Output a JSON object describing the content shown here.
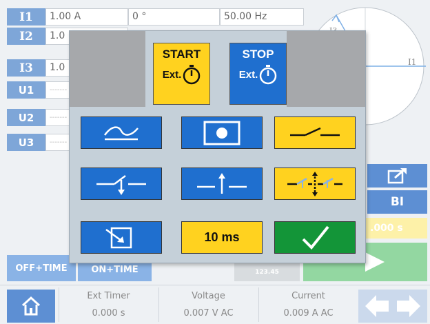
{
  "channels": [
    {
      "tag": "I1",
      "amplitude": "1.00 A",
      "phase": "0 °",
      "frequency": "50.00 Hz"
    },
    {
      "tag": "I2",
      "amplitude": "1.0"
    },
    {
      "tag": "I3",
      "amplitude": "1.0"
    },
    {
      "tag": "U1",
      "amplitude": "-------"
    },
    {
      "tag": "U2",
      "amplitude": "-------"
    },
    {
      "tag": "U3",
      "amplitude": "-------"
    }
  ],
  "vector_labels": {
    "i1": "I1",
    "i3": "I3"
  },
  "right_panel": {
    "bi_label": "BI",
    "time_value": ".000 s",
    "export_icon": "export-icon"
  },
  "mode_buttons": {
    "off_time": "OFF+TIME",
    "on_time": "ON+TIME",
    "counter": "123.45"
  },
  "status": {
    "ext_timer_label": "Ext Timer",
    "ext_timer_value": "0.000 s",
    "voltage_label": "Voltage",
    "voltage_value": "0.007 V AC",
    "current_label": "Current",
    "current_value": "0.009 A AC"
  },
  "dialog": {
    "start": {
      "label": "START",
      "sub": "Ext."
    },
    "stop": {
      "label": "STOP",
      "sub": "Ext."
    },
    "delay_label": "10 ms",
    "icons": [
      "sine-wave-icon",
      "record-icon",
      "contact-open-icon",
      "contact-down-icon",
      "contact-up-icon",
      "contact-both-icon",
      "load-file-icon",
      "confirm-check-icon"
    ]
  },
  "colors": {
    "accent_blue": "#1f6fcf",
    "accent_yellow": "#ffd21f",
    "confirm_green": "#139538"
  }
}
